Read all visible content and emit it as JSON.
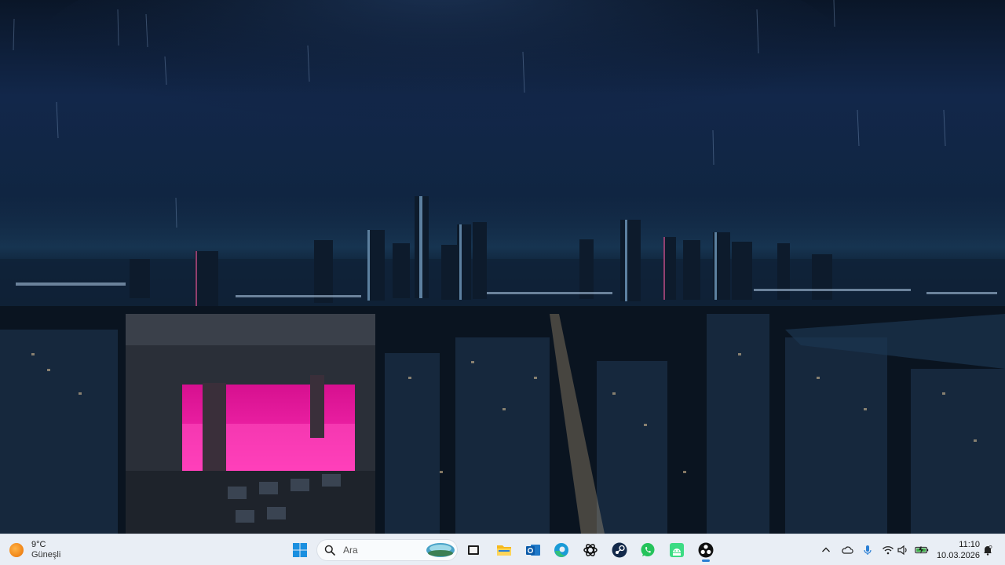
{
  "weather": {
    "temperature": "9°C",
    "condition": "Güneşli",
    "icon": "sun-icon"
  },
  "search": {
    "placeholder": "Ara"
  },
  "taskbar_apps": [
    {
      "name": "task-view",
      "icon": "task-view-icon"
    },
    {
      "name": "file-explorer",
      "icon": "folder-icon"
    },
    {
      "name": "outlook",
      "icon": "outlook-icon"
    },
    {
      "name": "edge",
      "icon": "edge-icon"
    },
    {
      "name": "chatgpt",
      "icon": "chatgpt-icon"
    },
    {
      "name": "steam",
      "icon": "steam-icon"
    },
    {
      "name": "whatsapp",
      "icon": "whatsapp-icon"
    },
    {
      "name": "android-studio",
      "icon": "android-icon"
    },
    {
      "name": "obs",
      "icon": "obs-icon",
      "active": true
    }
  ],
  "tray": [
    "chevron-up-icon",
    "cloud-icon",
    "microphone-icon",
    "wifi-icon",
    "speaker-icon",
    "battery-icon"
  ],
  "clock": {
    "time": "11:10",
    "date": "10.03.2026"
  },
  "colors": {
    "taskbar_bg": "#e9eef5",
    "accent": "#2a7fd4",
    "neon_pink": "#e0169a"
  }
}
